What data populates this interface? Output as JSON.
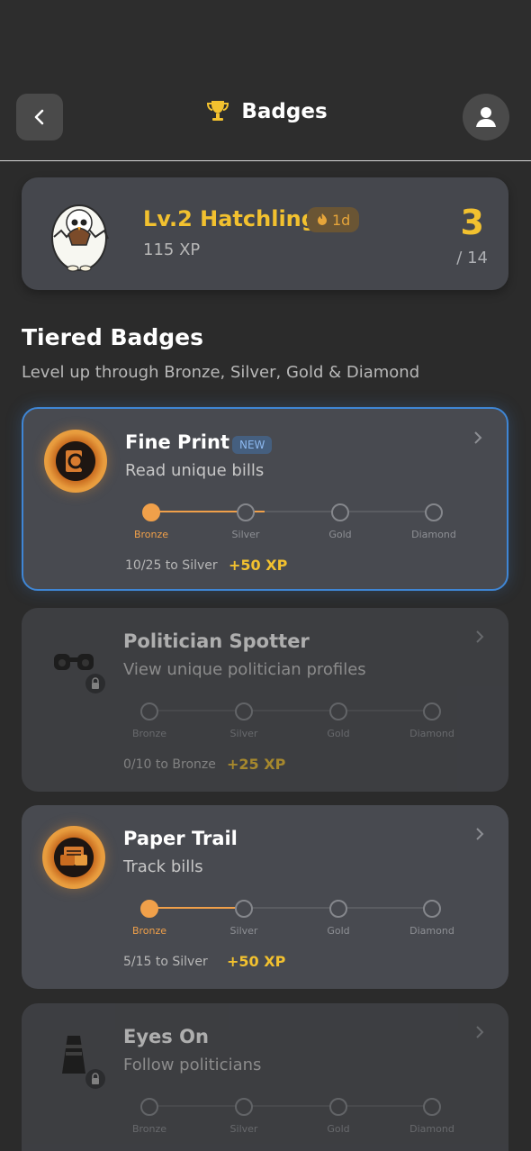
{
  "header": {
    "title": "Badges",
    "back_icon": "chevron-left-icon",
    "trophy_icon": "trophy-icon",
    "profile_icon": "user-icon"
  },
  "level_card": {
    "title": "Lv.2 Hatchling",
    "xp": "115 XP",
    "streak": "1d",
    "count": "3",
    "total": "/ 14"
  },
  "section": {
    "title": "Tiered Badges",
    "subtitle": "Level up through Bronze, Silver, Gold & Diamond"
  },
  "tiers": [
    "Bronze",
    "Silver",
    "Gold",
    "Diamond"
  ],
  "badges": [
    {
      "name": "Fine Print",
      "tag": "NEW",
      "description": "Read unique bills",
      "progress": "10/25 to Silver",
      "reward": "+50 XP",
      "tier_progress": 0.4
    },
    {
      "name": "Politician Spotter",
      "description": "View unique politician profiles",
      "progress": "0/10 to Bronze",
      "reward": "+25 XP",
      "tier_progress": 0
    },
    {
      "name": "Paper Trail",
      "description": "Track bills",
      "progress": "5/15 to Silver",
      "reward": "+50 XP",
      "tier_progress": 0.33
    },
    {
      "name": "Eyes On",
      "description": "Follow politicians",
      "tier_progress": 0
    }
  ],
  "colors": {
    "accent": "#f2c12f",
    "bronze": "#f0a04a",
    "active_border": "#3f86d5"
  }
}
